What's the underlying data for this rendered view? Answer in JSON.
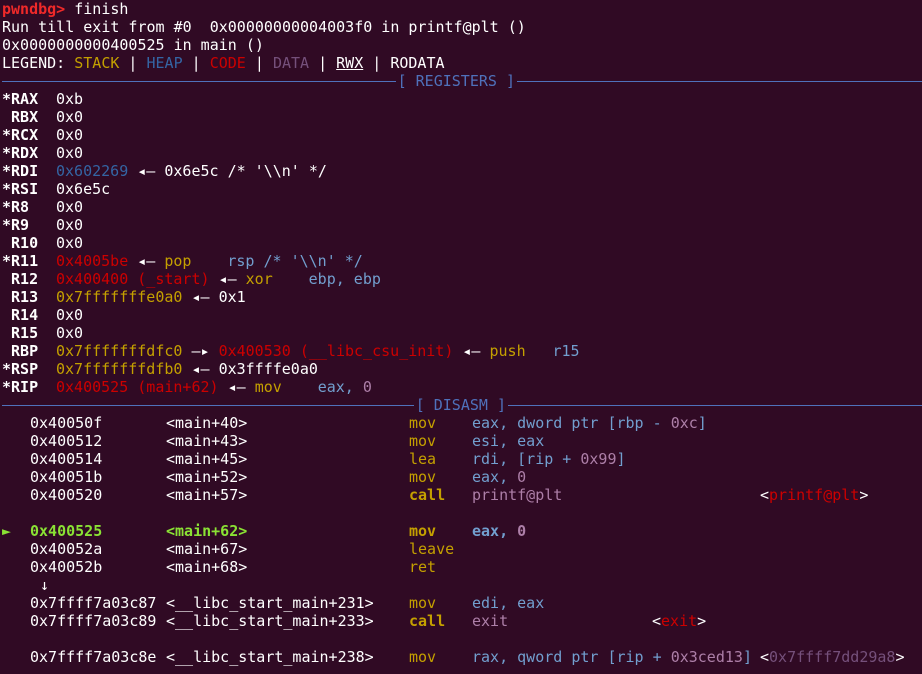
{
  "prompt": {
    "label": "pwndbg>",
    "command": " finish"
  },
  "output": [
    "Run till exit from #0  0x00000000004003f0 in printf@plt ()",
    "0x0000000000400525 in main ()"
  ],
  "legend": {
    "label": "LEGEND: ",
    "stack": "STACK",
    "heap": "HEAP",
    "code": "CODE",
    "data": "DATA",
    "rwx": "RWX",
    "rodata": "RODATA",
    "sep": " | "
  },
  "sections": {
    "registers": "[ REGISTERS ]",
    "disasm": "[ DISASM ]"
  },
  "arrow_left": " ◂— ",
  "arrow_right": " —▸ ",
  "registers": {
    "rax": {
      "name": "*RAX",
      "value": "0xb"
    },
    "rbx": {
      "name": " RBX",
      "value": "0x0"
    },
    "rcx": {
      "name": "*RCX",
      "value": "0x0"
    },
    "rdx": {
      "name": "*RDX",
      "value": "0x0"
    },
    "rdi": {
      "name": "*RDI",
      "value": "0x602269",
      "deref": "0x6e5c /* '\\\\n' */"
    },
    "rsi": {
      "name": "*RSI",
      "value": "0x6e5c"
    },
    "r8": {
      "name": "*R8",
      "value": "0x0"
    },
    "r9": {
      "name": "*R9",
      "value": "0x0"
    },
    "r10": {
      "name": " R10",
      "value": "0x0"
    },
    "r11": {
      "name": "*R11",
      "value": "0x4005be",
      "mn": "pop",
      "op": "rsp /* '\\\\n' */"
    },
    "r12": {
      "name": " R12",
      "value": "0x400400 (_start)",
      "mn": "xor",
      "op": "ebp, ebp"
    },
    "r13": {
      "name": " R13",
      "value": "0x7fffffffe0a0",
      "deref": "0x1"
    },
    "r14": {
      "name": " R14",
      "value": "0x0"
    },
    "r15": {
      "name": " R15",
      "value": "0x0"
    },
    "rbp": {
      "name": " RBP",
      "value": "0x7fffffffdfc0",
      "value2": "0x400530 (__libc_csu_init)",
      "mn": "push",
      "op": "r15"
    },
    "rsp": {
      "name": "*RSP",
      "value": "0x7fffffffdfb0",
      "deref": "0x3ffffe0a0"
    },
    "rip": {
      "name": "*RIP",
      "value": "0x400525 (main+62)",
      "mn": "mov",
      "op1": "eax, ",
      "op2": "0"
    }
  },
  "disasm": [
    {
      "addr": "0x40050f",
      "sym": "<main+40>",
      "mn": "mov",
      "ops": [
        "eax, dword ptr [rbp - ",
        "0xc",
        "]"
      ]
    },
    {
      "addr": "0x400512",
      "sym": "<main+43>",
      "mn": "mov",
      "ops": [
        "esi, eax"
      ]
    },
    {
      "addr": "0x400514",
      "sym": "<main+45>",
      "mn": "lea",
      "ops": [
        "rdi, [rip + ",
        "0x99",
        "]"
      ]
    },
    {
      "addr": "0x40051b",
      "sym": "<main+52>",
      "mn": "mov",
      "ops": [
        "eax, ",
        "0"
      ]
    },
    {
      "addr": "0x400520",
      "sym": "<main+57>",
      "mn": "call",
      "ops": [
        "printf@plt"
      ],
      "annot_open": "<",
      "annot": "printf@plt",
      "annot_close": ">"
    },
    {
      "marker": "►",
      "addr": "0x400525",
      "sym": "<main+62>",
      "mn": "mov",
      "ops": [
        "eax, ",
        "0"
      ]
    },
    {
      "addr": "0x40052a",
      "sym": "<main+67>",
      "mn": "leave"
    },
    {
      "addr": "0x40052b",
      "sym": "<main+68>",
      "mn": "ret"
    },
    {
      "jump": "↓"
    },
    {
      "addr": "0x7ffff7a03c87",
      "sym": "<__libc_start_main+231>",
      "mn": "mov",
      "ops": [
        "edi, eax"
      ]
    },
    {
      "addr": "0x7ffff7a03c89",
      "sym": "<__libc_start_main+233>",
      "mn": "call",
      "ops": [
        "exit"
      ],
      "annot_open": "<",
      "annot": "exit",
      "annot_close": ">"
    },
    {
      "addr": "0x7ffff7a03c8e",
      "sym": "<__libc_start_main+238>",
      "mn": "mov",
      "ops": [
        "rax, qword ptr [rip + ",
        "0x3ced13",
        "]"
      ],
      "annot_open": "<",
      "annot": "0x7ffff7dd29a8",
      "annot_close": ">"
    }
  ],
  "colors": {
    "background": "#300a24",
    "stack": "#c4a000",
    "heap": "#3465a4",
    "code": "#cc0000",
    "data": "#75507b",
    "current": "#8ae234",
    "mnemonic": "#c4a000",
    "operand": "#729fcf",
    "immediate": "#ad7fa8"
  }
}
